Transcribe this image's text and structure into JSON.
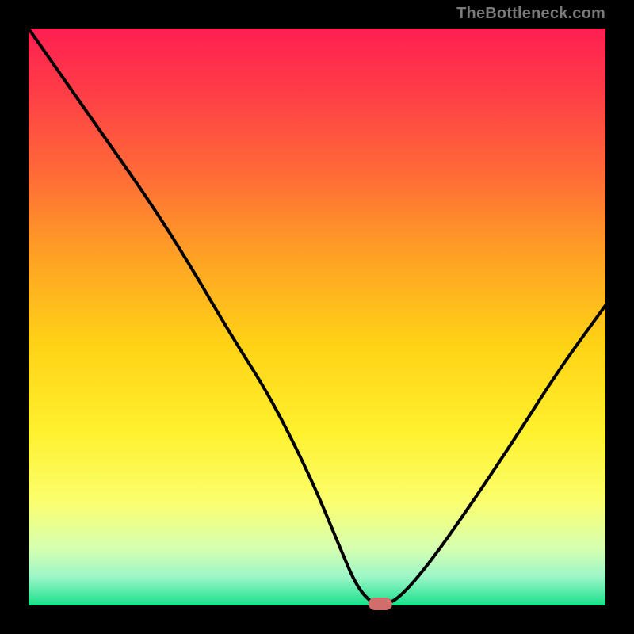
{
  "watermark": "TheBottleneck.com",
  "chart_data": {
    "type": "line",
    "title": "",
    "xlabel": "",
    "ylabel": "",
    "xlim": [
      0,
      100
    ],
    "ylim": [
      0,
      100
    ],
    "grid": false,
    "legend": null,
    "series": [
      {
        "name": "bottleneck-curve",
        "x": [
          0,
          7,
          14,
          21,
          28,
          35,
          42,
          49,
          54,
          57,
          60,
          62,
          65,
          70,
          77,
          85,
          92,
          100
        ],
        "y": [
          100,
          90,
          80,
          70,
          59,
          47,
          36,
          22,
          10,
          3,
          0,
          0,
          2,
          8,
          18,
          30,
          41,
          52
        ]
      }
    ],
    "marker": {
      "x": 61,
      "y": 0
    },
    "gradient_stops": [
      {
        "pos": 0.0,
        "color": "#ff1f52"
      },
      {
        "pos": 0.1,
        "color": "#ff3a48"
      },
      {
        "pos": 0.25,
        "color": "#ff6a37"
      },
      {
        "pos": 0.4,
        "color": "#ffa324"
      },
      {
        "pos": 0.55,
        "color": "#ffd315"
      },
      {
        "pos": 0.7,
        "color": "#fff12e"
      },
      {
        "pos": 0.82,
        "color": "#fbff6e"
      },
      {
        "pos": 0.9,
        "color": "#d7ffb0"
      },
      {
        "pos": 0.95,
        "color": "#9cf6c8"
      },
      {
        "pos": 0.98,
        "color": "#4de9a4"
      },
      {
        "pos": 1.0,
        "color": "#14e28a"
      }
    ]
  }
}
